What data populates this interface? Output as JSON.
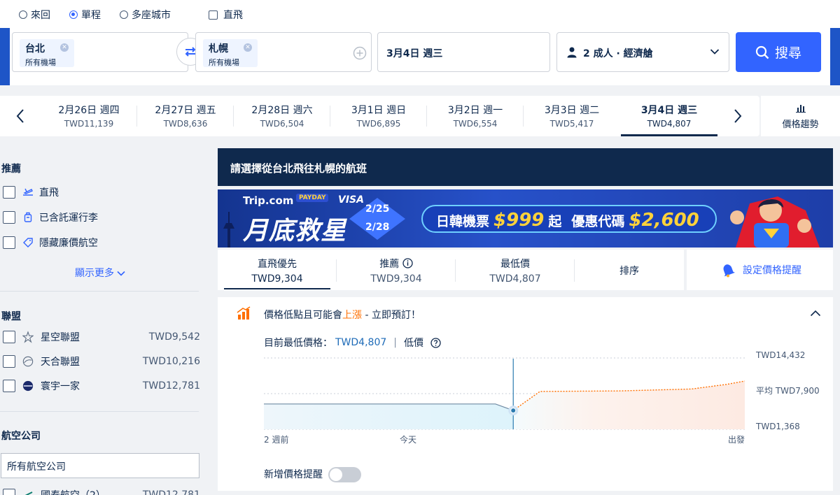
{
  "trip_types": [
    {
      "label": "來回",
      "selected": false
    },
    {
      "label": "單程",
      "selected": true
    },
    {
      "label": "多座城市",
      "selected": false
    }
  ],
  "direct_label": "直飛",
  "search": {
    "from_city": "台北",
    "from_sub": "所有機場",
    "to_city": "札幌",
    "to_sub": "所有機場",
    "date": "3月4日 週三",
    "passengers": "2 成人 · 經濟艙",
    "button": "搜尋"
  },
  "dates": [
    {
      "date": "2月26日 週四",
      "price": "TWD11,139"
    },
    {
      "date": "2月27日 週五",
      "price": "TWD8,636"
    },
    {
      "date": "2月28日 週六",
      "price": "TWD6,504"
    },
    {
      "date": "3月1日 週日",
      "price": "TWD6,895"
    },
    {
      "date": "3月2日 週一",
      "price": "TWD6,554"
    },
    {
      "date": "3月3日 週二",
      "price": "TWD5,417"
    },
    {
      "date": "3月4日 週三",
      "price": "TWD4,807",
      "active": true
    }
  ],
  "price_trend_label": "價格趨勢",
  "sidebar": {
    "recommend_title": "推薦",
    "recommend_items": [
      "直飛",
      "已含託運行李",
      "隱藏廉價航空"
    ],
    "show_more": "顯示更多",
    "alliance_title": "聯盟",
    "alliances": [
      {
        "name": "星空聯盟",
        "price": "TWD9,542"
      },
      {
        "name": "天合聯盟",
        "price": "TWD10,216"
      },
      {
        "name": "寰宇一家",
        "price": "TWD12,781"
      }
    ],
    "airline_title": "航空公司",
    "airline_select": "所有航空公司",
    "airline_first": {
      "name": "國泰航空（2）",
      "price": "TWD12,781"
    }
  },
  "main": {
    "header": "請選擇從台北飛往札幌的航班",
    "promo": {
      "brand": "Trip.com",
      "payday": "PAYDAY",
      "visa": "VISA",
      "title": "月底救星",
      "date_from": "2/25",
      "date_to": "2/28",
      "offer_1": "日韓機票",
      "offer_1_price": "$999",
      "offer_1_suffix": "起",
      "offer_2": "優惠代碼",
      "offer_2_price": "$2,600"
    },
    "sort_tabs": [
      {
        "title": "直飛優先",
        "value": "TWD9,304",
        "active": true
      },
      {
        "title": "推薦",
        "value": "TWD9,304",
        "info": true
      },
      {
        "title": "最低價",
        "value": "TWD4,807"
      },
      {
        "title": "排序",
        "value": ""
      }
    ],
    "set_alert": "設定價格提醒",
    "price_panel": {
      "headline_a": "價格低點且可能會",
      "headline_rise": "上漲",
      "headline_b": " - 立即預訂！",
      "current_label": "目前最低價格：",
      "current_value": "TWD4,807",
      "sep": "|",
      "low_label": "低價",
      "y_high": "TWD14,432",
      "y_avg": "平均 TWD7,900",
      "y_low": "TWD1,368",
      "x_start": "2 週前",
      "x_today": "今天",
      "x_end": "出發",
      "add_alert": "新增價格提醒"
    }
  },
  "chart_data": {
    "type": "line",
    "x": [
      "2 週前",
      "今天",
      "出發"
    ],
    "ylim": [
      1368,
      14432
    ],
    "average": 7900,
    "series": [
      {
        "values": [
          [
            -14,
            6000
          ],
          [
            -1,
            6000
          ],
          [
            0,
            4807
          ]
        ]
      },
      {
        "values": [
          [
            0,
            4807
          ],
          [
            1.5,
            8300
          ],
          [
            6,
            8400
          ],
          [
            10,
            8750
          ],
          [
            12,
            9600
          ],
          [
            13,
            10200
          ]
        ]
      }
    ]
  },
  "colors": {
    "primary": "#3264ff",
    "navy": "#0f294d",
    "rise": "#ff6f00"
  }
}
